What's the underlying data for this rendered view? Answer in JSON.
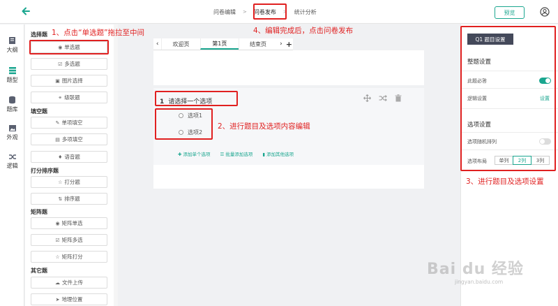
{
  "header": {
    "steps": [
      "问卷编辑",
      "问卷发布",
      "统计分析"
    ],
    "separator": ">",
    "preview_label": "预览"
  },
  "leftnav": {
    "items": [
      {
        "label": "大纲",
        "icon": "outline-icon"
      },
      {
        "label": "题型",
        "icon": "question-types-icon"
      },
      {
        "label": "题库",
        "icon": "question-bank-icon"
      },
      {
        "label": "外观",
        "icon": "appearance-icon"
      },
      {
        "label": "逻辑",
        "icon": "logic-icon"
      }
    ]
  },
  "palette": {
    "groups": [
      {
        "title": "选择题",
        "items": [
          {
            "label": "单选题",
            "icon": "◉"
          },
          {
            "label": "多选题",
            "icon": "☑"
          },
          {
            "label": "图片选择",
            "icon": "▣"
          },
          {
            "label": "级联题",
            "icon": "⚭"
          }
        ]
      },
      {
        "title": "填空题",
        "items": [
          {
            "label": "单项填空",
            "icon": "✎"
          },
          {
            "label": "多项填空",
            "icon": "▤"
          },
          {
            "label": "语音题",
            "icon": "♦"
          }
        ]
      },
      {
        "title": "打分排序题",
        "items": [
          {
            "label": "打分题",
            "icon": "☆"
          },
          {
            "label": "排序题",
            "icon": "⇅"
          }
        ]
      },
      {
        "title": "矩阵题",
        "items": [
          {
            "label": "矩阵单选",
            "icon": "◉"
          },
          {
            "label": "矩阵多选",
            "icon": "☑"
          },
          {
            "label": "矩阵打分",
            "icon": "☆"
          }
        ]
      },
      {
        "title": "其它题",
        "items": [
          {
            "label": "文件上传",
            "icon": "☁"
          },
          {
            "label": "地理位置",
            "icon": "➤"
          }
        ]
      }
    ]
  },
  "canvas": {
    "tabs": [
      "欢迎页",
      "第1页",
      "结束页"
    ],
    "question": {
      "number": "1",
      "title": "请选择一个选项",
      "options": [
        "选项1",
        "选项2"
      ]
    },
    "add_links": [
      "添加单个选项",
      "批量添加选项",
      "添加其他选项"
    ]
  },
  "settings": {
    "header_label": "Q1 题目设置",
    "sections": {
      "whole": "整题设置",
      "options": "选项设置"
    },
    "rows": {
      "required": "此题必答",
      "required_on": true,
      "logic": "逻辑设置",
      "logic_link": "设置",
      "random": "选项随机排列",
      "random_on": false,
      "layout": "选项布局"
    },
    "layout_options": [
      "单列",
      "2列",
      "3列"
    ],
    "layout_selected": 1
  },
  "annotations": {
    "step1": "1、点击“单选题”拖拉至中间",
    "step2": "2、进行题目及选项内容编辑",
    "step3": "3、进行题目及选项设置",
    "step4": "4、编辑完成后，点击问卷发布"
  },
  "watermark": {
    "main": "Bai du 经验",
    "sub": "jingyan.baidu.com"
  },
  "colors": {
    "accent": "#1aa68f",
    "annotation": "#e02020",
    "settings_header": "#44495a"
  }
}
